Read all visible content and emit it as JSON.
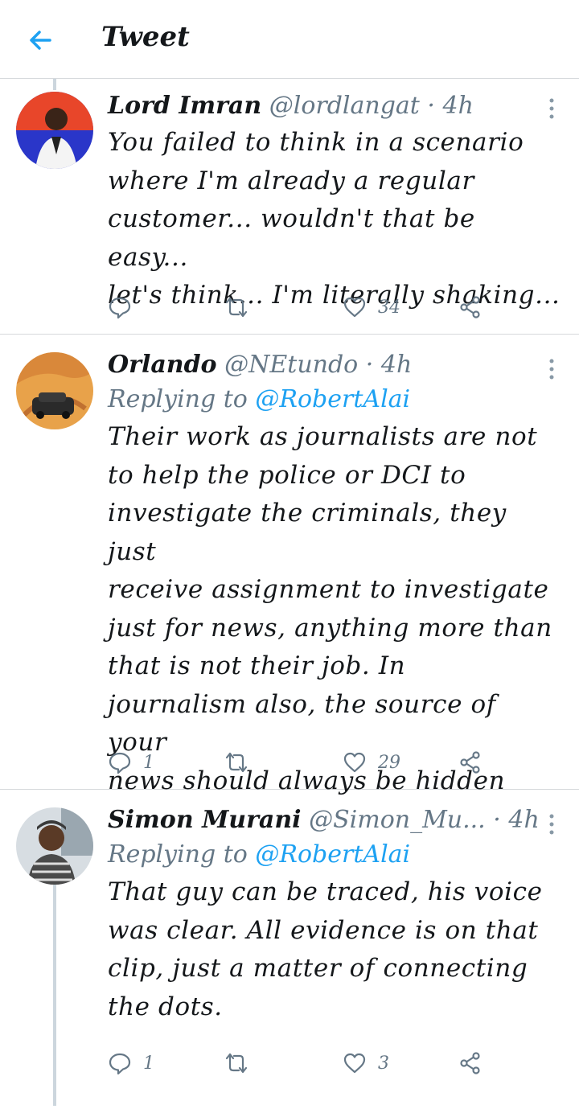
{
  "header": {
    "title": "Tweet"
  },
  "tweets": [
    {
      "name": "Lord Imran",
      "handle": "@lordlangat",
      "dot": "·",
      "time": "4h",
      "replying_prefix": "",
      "replying_to": "",
      "text": "You failed to think in a scenario\nwhere I'm already a regular\ncustomer... wouldn't that be easy...\nlet's think... I'm literally shaking...",
      "reply_count": "",
      "retweet_count": "",
      "like_count": "34"
    },
    {
      "name": "Orlando",
      "handle": "@NEtundo",
      "dot": "·",
      "time": "4h",
      "replying_prefix": "Replying to ",
      "replying_to": "@RobertAlai",
      "text": "Their work as journalists are not\nto help the police or DCI to\ninvestigate the criminals, they just\nreceive assignment to investigate\njust for news, anything more than\nthat is not their job. In\njournalism also, the source of your\nnews should always be hidden",
      "reply_count": "1",
      "retweet_count": "",
      "like_count": "29"
    },
    {
      "name": "Simon Murani",
      "handle": "@Simon_Mu...",
      "dot": "·",
      "time": "4h",
      "replying_prefix": "Replying to ",
      "replying_to": "@RobertAlai",
      "text": "That guy can be traced, his voice\nwas clear. All evidence is on that\nclip, just a matter of connecting\nthe dots.",
      "reply_count": "1",
      "retweet_count": "",
      "like_count": "3"
    }
  ],
  "colors": {
    "accent": "#1da1f2",
    "muted": "#657786",
    "divider": "#d6d9dc",
    "thread_line": "#ccd6dd"
  },
  "icons": {
    "back": "arrow-left-icon",
    "more": "more-vertical-icon",
    "reply": "reply-bubble-icon",
    "retweet": "retweet-icon",
    "like": "heart-icon",
    "share": "share-icon"
  }
}
